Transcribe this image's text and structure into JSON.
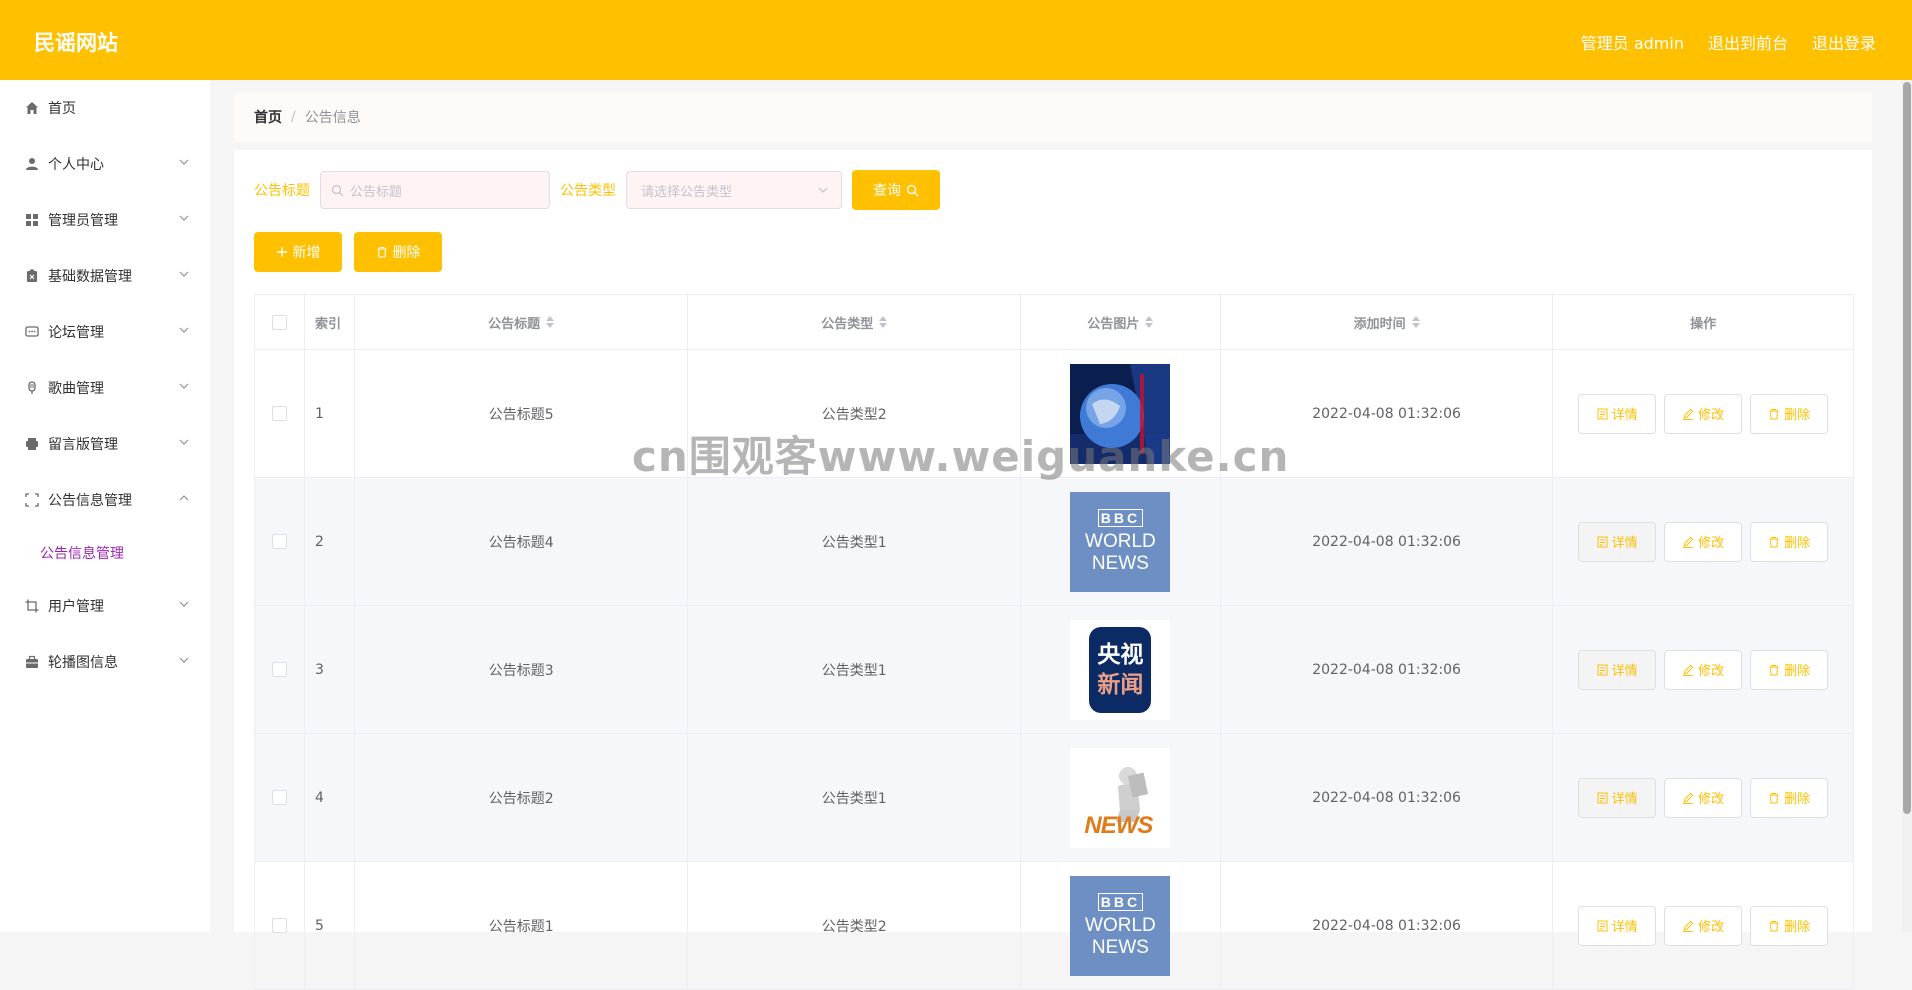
{
  "header": {
    "logo": "民谣网站",
    "user": "管理员 admin",
    "to_front": "退出到前台",
    "logout": "退出登录"
  },
  "sidebar": {
    "items": [
      {
        "label": "首页",
        "icon": "home-icon"
      },
      {
        "label": "个人中心",
        "icon": "user-icon"
      },
      {
        "label": "管理员管理",
        "icon": "grid-icon"
      },
      {
        "label": "基础数据管理",
        "icon": "clipboard-icon"
      },
      {
        "label": "论坛管理",
        "icon": "chat-icon"
      },
      {
        "label": "歌曲管理",
        "icon": "mic-icon"
      },
      {
        "label": "留言版管理",
        "icon": "printer-icon"
      },
      {
        "label": "公告信息管理",
        "icon": "fullscreen-icon"
      },
      {
        "label": "用户管理",
        "icon": "crop-icon"
      },
      {
        "label": "轮播图信息",
        "icon": "briefcase-icon"
      }
    ],
    "sub_item": "公告信息管理"
  },
  "breadcrumb": {
    "home": "首页",
    "current": "公告信息"
  },
  "search": {
    "title_label": "公告标题",
    "title_placeholder": "公告标题",
    "type_label": "公告类型",
    "type_placeholder": "请选择公告类型",
    "query_label": "查询"
  },
  "actions": {
    "add_label": "新增",
    "delete_label": "删除"
  },
  "table": {
    "headers": {
      "index": "索引",
      "title": "公告标题",
      "type": "公告类型",
      "image": "公告图片",
      "time": "添加时间",
      "ops": "操作"
    },
    "op_labels": {
      "detail": "详情",
      "edit": "修改",
      "delete": "删除"
    },
    "rows": [
      {
        "index": "1",
        "title": "公告标题5",
        "type": "公告类型2",
        "time": "2022-04-08 01:32:06",
        "image": "globe-news-image"
      },
      {
        "index": "2",
        "title": "公告标题4",
        "type": "公告类型1",
        "time": "2022-04-08 01:32:06",
        "image": "bbc-world-news-image"
      },
      {
        "index": "3",
        "title": "公告标题3",
        "type": "公告类型1",
        "time": "2022-04-08 01:32:06",
        "image": "cctv-news-image"
      },
      {
        "index": "4",
        "title": "公告标题2",
        "type": "公告类型1",
        "time": "2022-04-08 01:32:06",
        "image": "news-figure-image"
      },
      {
        "index": "5",
        "title": "公告标题1",
        "type": "公告类型2",
        "time": "2022-04-08 01:32:06",
        "image": "bbc-world-news-image"
      }
    ]
  },
  "thumb_text": {
    "bbc": "BBC",
    "world": "WORLD",
    "news": "NEWS",
    "cctv_top": "央视",
    "cctv_bottom": "新闻",
    "news_figure": "NEWS"
  },
  "watermark": "cn围观客www.weiguanke.cn",
  "colors": {
    "accent": "#ffc000",
    "sub_active": "#9c27b0"
  }
}
